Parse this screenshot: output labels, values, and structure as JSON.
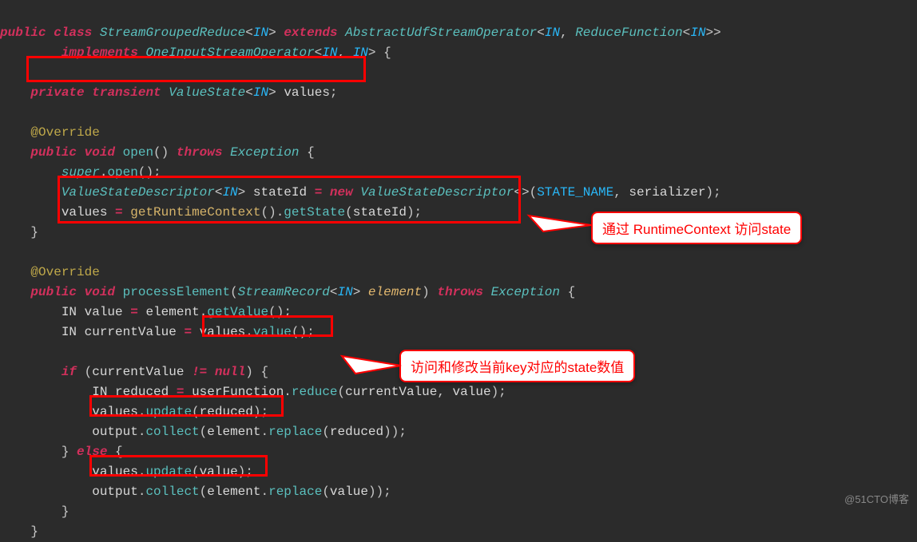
{
  "code": {
    "l1_public": "public",
    "l1_class": "class",
    "l1_name": "StreamGroupedReduce",
    "l1_in": "IN",
    "l1_extends": "extends",
    "l1_abs": "AbstractUdfStreamOperator",
    "l1_rf": "ReduceFunction",
    "l2_impl": "implements",
    "l2_one": "OneInputStreamOperator",
    "l3_private": "private",
    "l3_transient": "transient",
    "l3_vs": "ValueState",
    "l3_values": "values",
    "l4_anno": "@Override",
    "l5_public": "public",
    "l5_void": "void",
    "l5_open": "open",
    "l5_throws": "throws",
    "l5_exc": "Exception",
    "l6_super": "super",
    "l6_open": "open",
    "l7_vsd": "ValueStateDescriptor",
    "l7_stateId": "stateId",
    "l7_new": "new",
    "l7_sn": "STATE_NAME",
    "l7_ser": "serializer",
    "l8_values": "values",
    "l8_grc": "getRuntimeContext",
    "l8_gs": "getState",
    "l8_si": "stateId",
    "l10_anno": "@Override",
    "l11_public": "public",
    "l11_void": "void",
    "l11_pe": "processElement",
    "l11_sr": "StreamRecord",
    "l11_el": "element",
    "l11_throws": "throws",
    "l11_exc": "Exception",
    "l12_in": "IN",
    "l12_value": "value",
    "l12_el": "element",
    "l12_gv": "getValue",
    "l13_in": "IN",
    "l13_cv": "currentValue",
    "l13_values": "values",
    "l13_value": "value",
    "l15_if": "if",
    "l15_cv": "currentValue",
    "l15_null": "null",
    "l16_in": "IN",
    "l16_red": "reduced",
    "l16_uf": "userFunction",
    "l16_reduce": "reduce",
    "l16_cv": "currentValue",
    "l16_val": "value",
    "l17_values": "values",
    "l17_update": "update",
    "l17_red": "reduced",
    "l18_out": "output",
    "l18_col": "collect",
    "l18_el": "element",
    "l18_rep": "replace",
    "l18_red": "reduced",
    "l19_else": "else",
    "l20_values": "values",
    "l20_update": "update",
    "l20_val": "value",
    "l21_out": "output",
    "l21_col": "collect",
    "l21_el": "element",
    "l21_rep": "replace",
    "l21_val": "value"
  },
  "callout1": "通过 RuntimeContext 访问state",
  "callout2": "访问和修改当前key对应的state数值",
  "watermark": "@51CTO博客"
}
